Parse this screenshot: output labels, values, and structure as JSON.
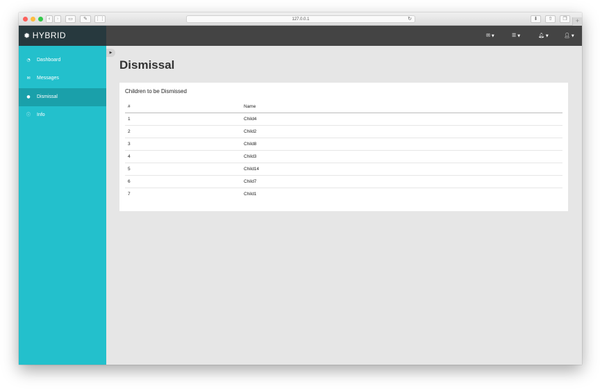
{
  "browser": {
    "url": "127.0.0.1"
  },
  "brand": {
    "name": "HYBRID"
  },
  "sidebar": {
    "items": [
      {
        "label": "Dashboard",
        "icon": "dashboard-icon"
      },
      {
        "label": "Messages",
        "icon": "envelope-icon"
      },
      {
        "label": "Dismissal",
        "icon": "user-icon",
        "active": true
      },
      {
        "label": "Info",
        "icon": "info-icon"
      }
    ]
  },
  "page": {
    "title": "Dismissal"
  },
  "panel": {
    "title": "Children to be Dismissed",
    "columns": [
      "#",
      "Name"
    ],
    "rows": [
      {
        "num": "1",
        "name": "Child4"
      },
      {
        "num": "2",
        "name": "Child2"
      },
      {
        "num": "3",
        "name": "Child8"
      },
      {
        "num": "4",
        "name": "Child3"
      },
      {
        "num": "5",
        "name": "Child14"
      },
      {
        "num": "6",
        "name": "Child7"
      },
      {
        "num": "7",
        "name": "Child1"
      }
    ]
  },
  "colors": {
    "sidebar": "#23c0cc",
    "sidebar_active": "#1aa0aa",
    "topbar": "#444444",
    "brand_bg": "#27393e"
  }
}
